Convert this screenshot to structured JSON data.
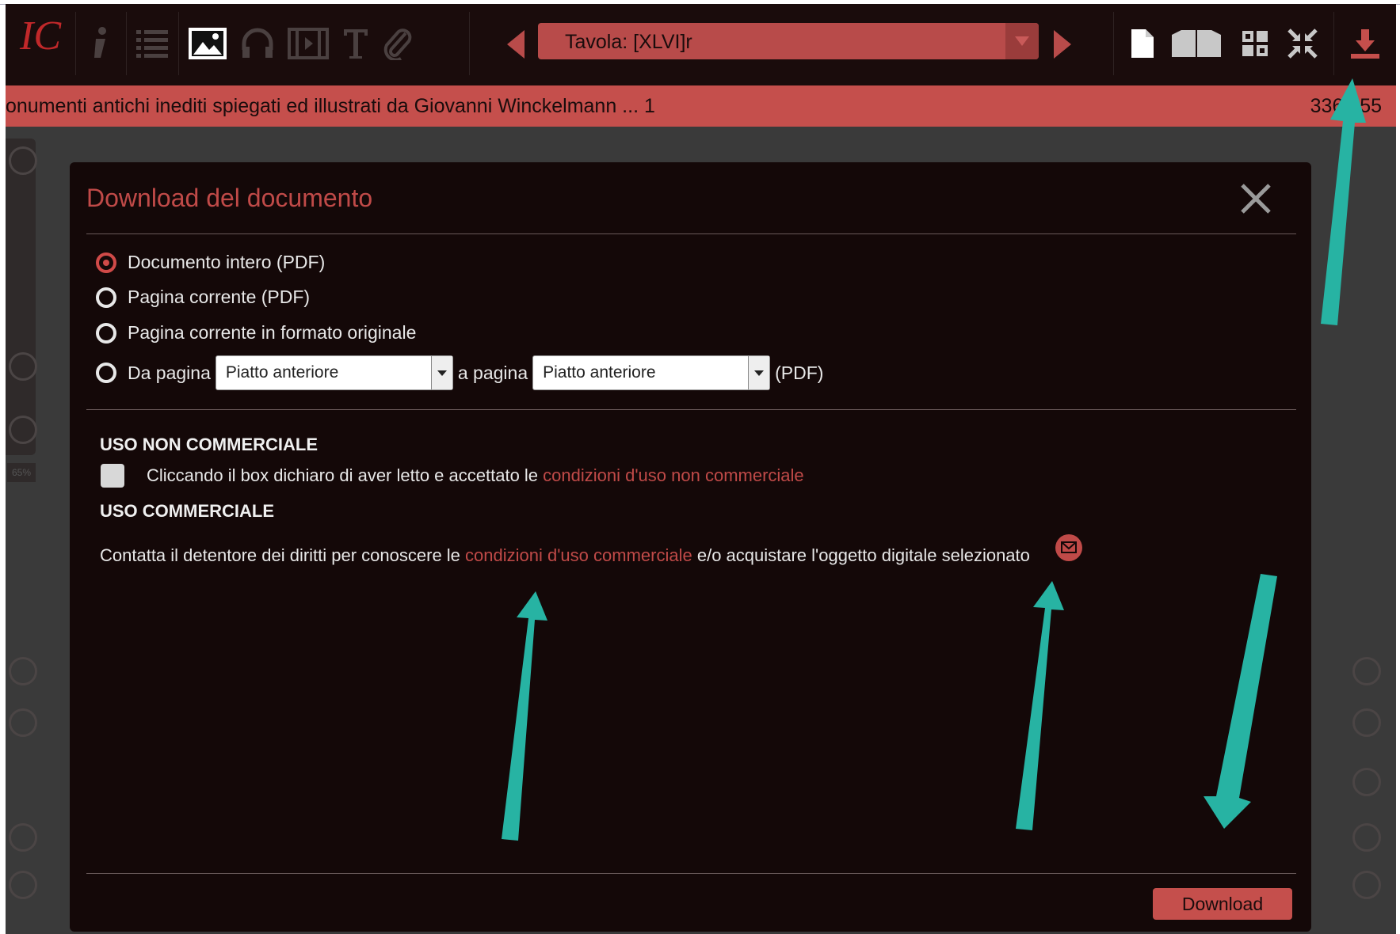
{
  "toolbar": {
    "logo": "IC",
    "page_select_value": "Tavola: [XLVI]r"
  },
  "titlebar": {
    "title": "onumenti antichi inediti spiegati ed illustrati da Giovanni Winckelmann ... 1",
    "pages": "336 / 55"
  },
  "side": {
    "zoom": "65%"
  },
  "modal": {
    "title": "Download del documento",
    "options": [
      {
        "label": "Documento intero (PDF)",
        "selected": true
      },
      {
        "label": "Pagina corrente (PDF)",
        "selected": false
      },
      {
        "label": "Pagina corrente in formato originale",
        "selected": false
      }
    ],
    "range": {
      "from_label": "Da pagina",
      "from_value": "Piatto anteriore",
      "to_label": "a pagina",
      "to_value": "Piatto anteriore",
      "suffix": "(PDF)"
    },
    "non_commercial": {
      "heading": "USO NON COMMERCIALE",
      "text": "Cliccando il box dichiaro di aver letto e accettato le",
      "link": "condizioni d'uso non commerciale"
    },
    "commercial": {
      "heading": "USO COMMERCIALE",
      "text_before": "Contatta il detentore dei diritti per conoscere le",
      "link": "condizioni d'uso commerciale",
      "text_after": "e/o acquistare l'oggetto digitale selezionato"
    },
    "download_label": "Download"
  },
  "colors": {
    "accent": "#c54f4c",
    "annotation_arrow": "#27b3a3",
    "modal_bg": "#140808"
  }
}
